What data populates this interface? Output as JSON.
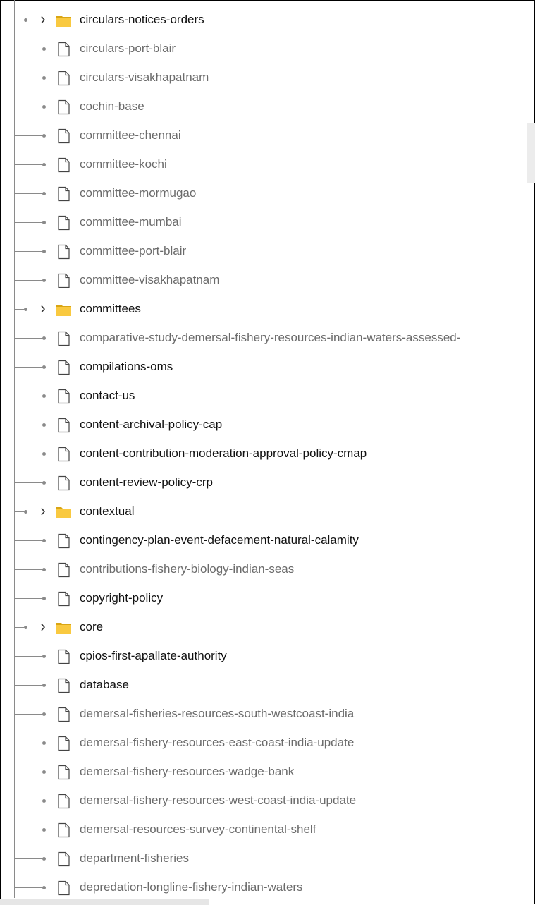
{
  "tree": {
    "items": [
      {
        "type": "folder",
        "name": "circulars-notices-orders",
        "muted": false
      },
      {
        "type": "file",
        "name": "circulars-port-blair",
        "muted": true
      },
      {
        "type": "file",
        "name": "circulars-visakhapatnam",
        "muted": true
      },
      {
        "type": "file",
        "name": "cochin-base",
        "muted": true
      },
      {
        "type": "file",
        "name": "committee-chennai",
        "muted": true
      },
      {
        "type": "file",
        "name": "committee-kochi",
        "muted": true
      },
      {
        "type": "file",
        "name": "committee-mormugao",
        "muted": true
      },
      {
        "type": "file",
        "name": "committee-mumbai",
        "muted": true
      },
      {
        "type": "file",
        "name": "committee-port-blair",
        "muted": true
      },
      {
        "type": "file",
        "name": "committee-visakhapatnam",
        "muted": true
      },
      {
        "type": "folder",
        "name": "committees",
        "muted": false
      },
      {
        "type": "file",
        "name": "comparative-study-demersal-fishery-resources-indian-waters-assessed-",
        "muted": true
      },
      {
        "type": "file",
        "name": "compilations-oms",
        "muted": false
      },
      {
        "type": "file",
        "name": "contact-us",
        "muted": false
      },
      {
        "type": "file",
        "name": "content-archival-policy-cap",
        "muted": false
      },
      {
        "type": "file",
        "name": "content-contribution-moderation-approval-policy-cmap",
        "muted": false
      },
      {
        "type": "file",
        "name": "content-review-policy-crp",
        "muted": false
      },
      {
        "type": "folder",
        "name": "contextual",
        "muted": false
      },
      {
        "type": "file",
        "name": "contingency-plan-event-defacement-natural-calamity",
        "muted": false
      },
      {
        "type": "file",
        "name": "contributions-fishery-biology-indian-seas",
        "muted": true
      },
      {
        "type": "file",
        "name": "copyright-policy",
        "muted": false
      },
      {
        "type": "folder",
        "name": "core",
        "muted": false
      },
      {
        "type": "file",
        "name": "cpios-first-apallate-authority",
        "muted": false
      },
      {
        "type": "file",
        "name": "database",
        "muted": false
      },
      {
        "type": "file",
        "name": "demersal-fisheries-resources-south-westcoast-india",
        "muted": true
      },
      {
        "type": "file",
        "name": "demersal-fishery-resources-east-coast-india-update",
        "muted": true
      },
      {
        "type": "file",
        "name": "demersal-fishery-resources-wadge-bank",
        "muted": true
      },
      {
        "type": "file",
        "name": "demersal-fishery-resources-west-coast-india-update",
        "muted": true
      },
      {
        "type": "file",
        "name": "demersal-resources-survey-continental-shelf",
        "muted": true
      },
      {
        "type": "file",
        "name": "department-fisheries",
        "muted": true
      },
      {
        "type": "file",
        "name": "depredation-longline-fishery-indian-waters",
        "muted": true
      }
    ]
  },
  "icons": {
    "folder": "folder-icon",
    "file": "file-icon",
    "expand": "chevron-right-icon"
  },
  "colors": {
    "folder_fill": "#f9c940",
    "folder_edge": "#d9a514",
    "text": "#111111",
    "muted_text": "#6b6b6b",
    "tree_line": "#8a8a8a"
  }
}
